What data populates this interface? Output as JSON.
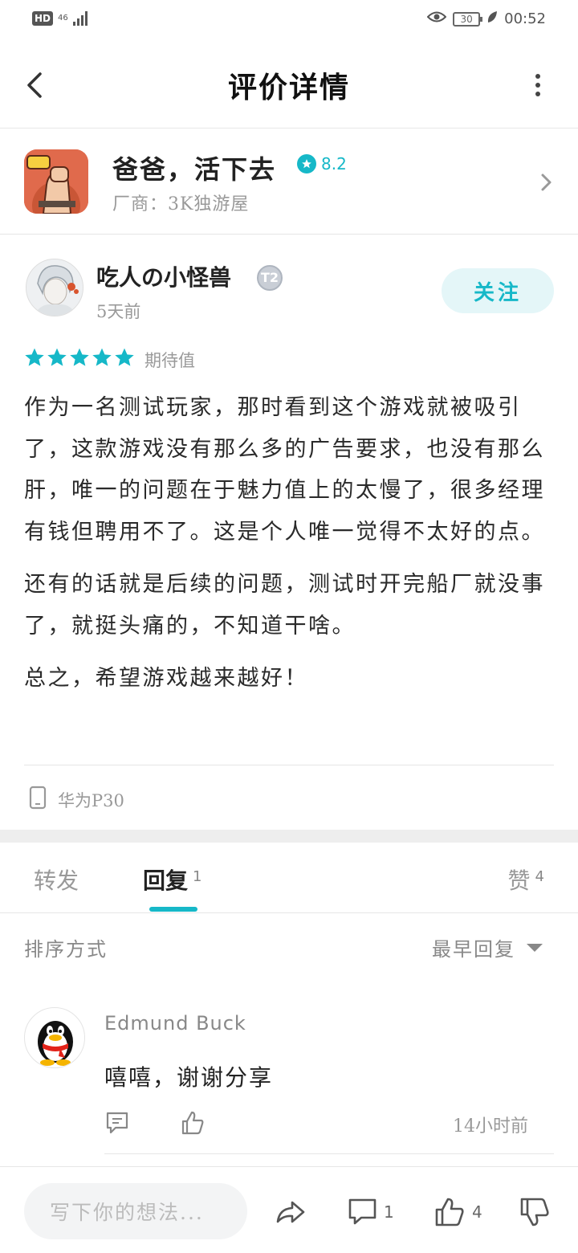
{
  "status_bar": {
    "hd": "HD",
    "network": "46",
    "battery": "30",
    "time": "00:52"
  },
  "header": {
    "title": "评价详情"
  },
  "game": {
    "name": "爸爸，活下去",
    "rating": "8.2",
    "vendor": "厂商：3K独游屋"
  },
  "review": {
    "username": "吃人の小怪兽",
    "level_badge": "T2",
    "posted": "5天前",
    "follow_label": "关注",
    "stars": 5,
    "star_color": "#16b8c8",
    "rating_label": "期待值",
    "paragraphs": [
      "作为一名测试玩家，那时看到这个游戏就被吸引了，这款游戏没有那么多的广告要求，也没有那么肝，唯一的问题在于魅力值上的太慢了，很多经理有钱但聘用不了。这是个人唯一觉得不太好的点。",
      "还有的话就是后续的问题，测试时开完船厂就没事了，就挺头痛的，不知道干啥。",
      "总之，希望游戏越来越好！"
    ],
    "device": "华为P30"
  },
  "tabs": {
    "forward": "转发",
    "reply": "回复",
    "reply_count": "1",
    "like": "赞",
    "like_count": "4"
  },
  "sort": {
    "label": "排序方式",
    "value": "最早回复"
  },
  "replies": [
    {
      "name": "Edmund Buck",
      "text": "嘻嘻，谢谢分享",
      "time": "14小时前"
    }
  ],
  "bottom_bar": {
    "compose_placeholder": "写下你的想法...",
    "comment_count": "1",
    "like_count": "4"
  },
  "colors": {
    "accent": "#16b8c8",
    "accent_light": "#e4f6f8"
  }
}
